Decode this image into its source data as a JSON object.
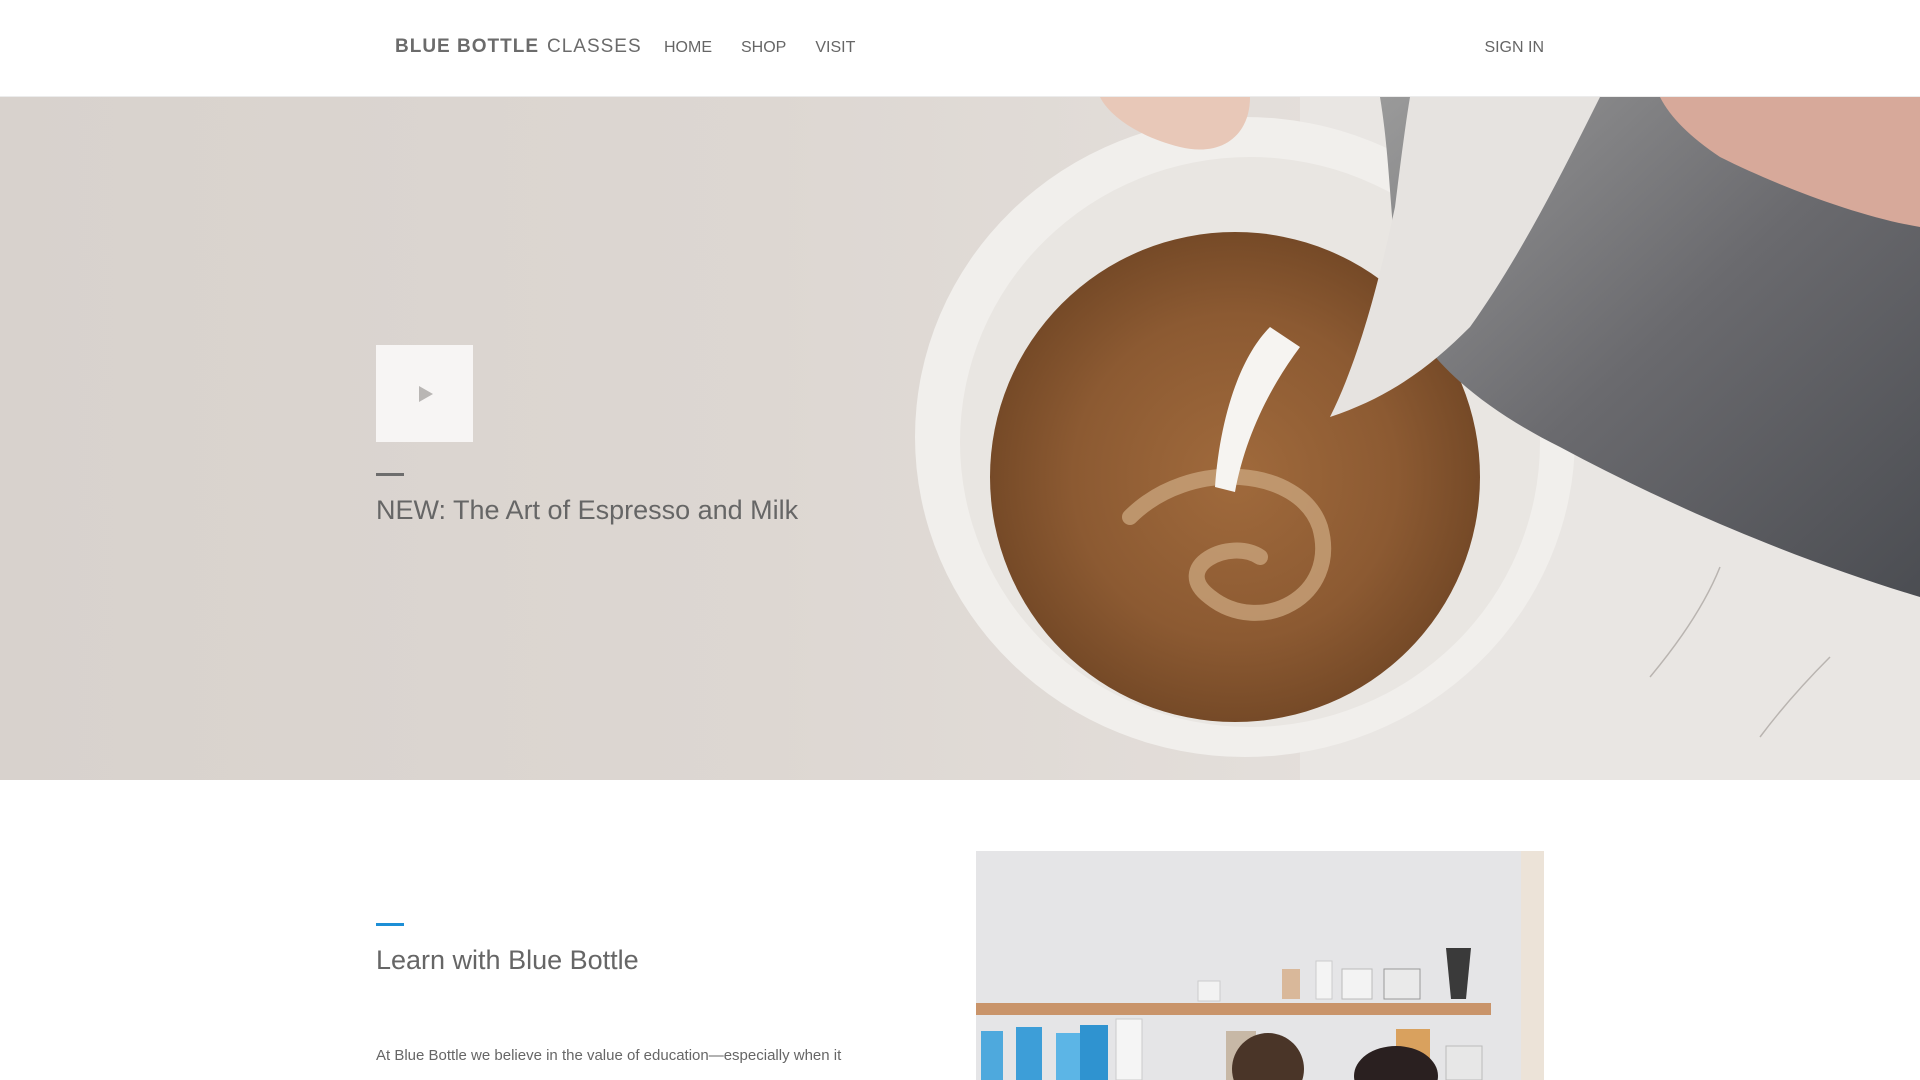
{
  "header": {
    "logo_strong": "BLUE BOTTLE",
    "logo_light": "CLASSES",
    "nav": [
      "HOME",
      "SHOP",
      "VISIT"
    ],
    "sign_in": "SIGN IN"
  },
  "hero": {
    "title": "NEW: The Art of Espresso and Milk",
    "play_icon": "play-icon"
  },
  "learn": {
    "title": "Learn with Blue Bottle",
    "body": "At Blue Bottle we believe in the value of education—especially when it"
  },
  "colors": {
    "accent": "#1d8fd6",
    "text": "#666666"
  }
}
